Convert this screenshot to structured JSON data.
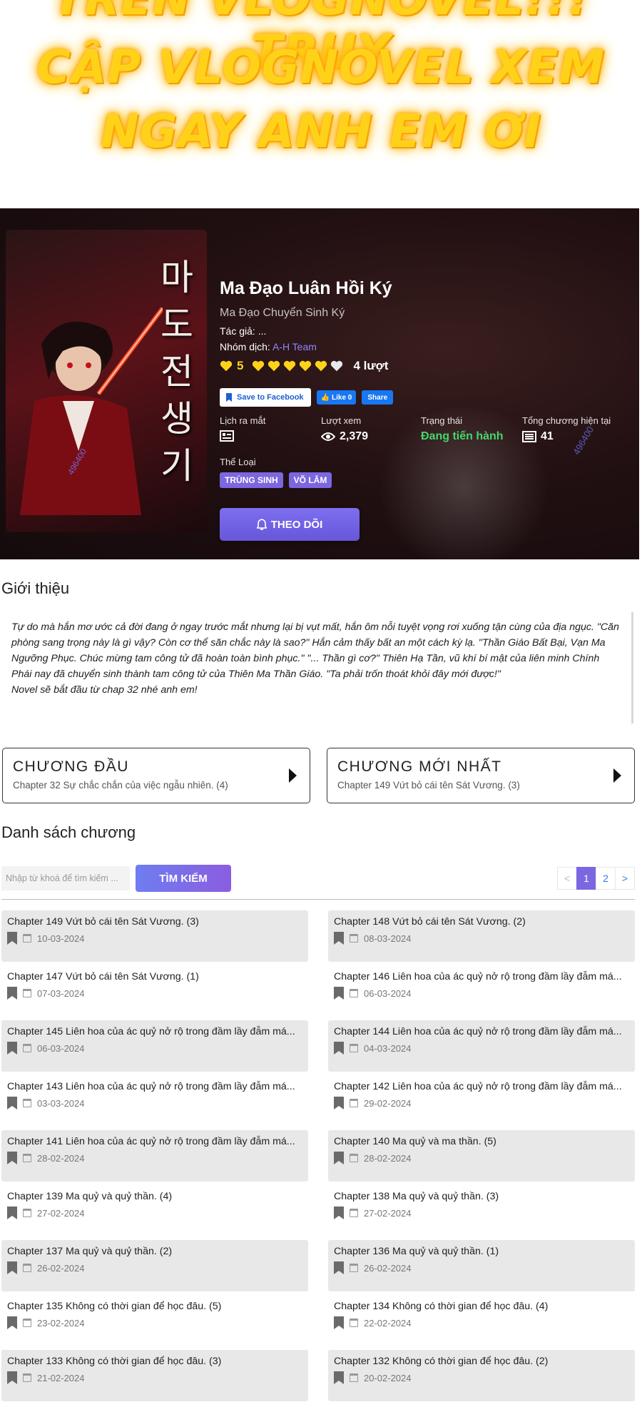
{
  "promo": {
    "line1": "TRÊN VLOGNOVEL!!! TRUY",
    "line2": "CẬP VLOGNOVEL XEM",
    "line3": "NGAY ANH EM ƠI"
  },
  "hero": {
    "title": "Ma Đạo Luân Hồi Ký",
    "alt_title": "Ma Đạo Chuyển Sinh Ký",
    "author_label": "Tác giả: ...",
    "team_label": "Nhóm dịch:",
    "team_name": "A-H Team",
    "rating_value": "5",
    "rating_count": "4 lượt",
    "hearts_filled": 5,
    "hearts_total": 6,
    "fb_save": "Save to Facebook",
    "fb_like": "Like 0",
    "fb_share": "Share",
    "cover_text": "마도전생기",
    "watermark": "496400",
    "stats": {
      "release_label": "Lịch ra mắt",
      "views_label": "Lượt xem",
      "views_value": "2,379",
      "status_label": "Trạng thái",
      "status_value": "Đang tiến hành",
      "chapters_label": "Tổng chương hiện tại",
      "chapters_value": "41"
    },
    "genre_label": "Thể Loại",
    "genres": [
      "TRÙNG SINH",
      "VÕ LÂM"
    ],
    "follow_label": "THEO DÕI"
  },
  "intro": {
    "title": "Giới thiệu",
    "paragraph": "Tự do mà hắn mơ ước cả đời đang ở ngay trước mắt nhưng lại bị vụt mất, hắn ôm nỗi tuyệt vọng rơi xuống tận cùng của địa ngục. \"Căn phòng sang trọng này là gì vậy? Còn cơ thể săn chắc này là sao?\" Hắn cảm thấy bất an một cách kỳ lạ. \"Thần Giáo Bất Bại, Vạn Ma Ngưỡng Phục. Chúc mừng tam công tử đã hoàn toàn bình phục.\" \"... Thần gì cơ?\" Thiên Hạ Tần, vũ khí bí mật của liên minh Chính Phái nay đã chuyển sinh thành tam công tử của Thiên Ma Thần Giáo. \"Ta phải trốn thoát khỏi đây mới được!\"",
    "note": "Novel sẽ bắt đầu từ chap 32 nhé anh em!"
  },
  "first_chapter": {
    "heading": "CHƯƠNG ĐẦU",
    "title": "Chapter 32 Sự chắc chắn của việc ngẫu nhiên. (4)"
  },
  "latest_chapter": {
    "heading": "CHƯƠNG MỚI NHẤT",
    "title": "Chapter 149 Vứt bỏ cái tên Sát Vương. (3)"
  },
  "chapter_list": {
    "title": "Danh sách chương",
    "search_placeholder": "Nhập từ khoá để tìm kiếm ...",
    "search_button": "TÌM KIẾM",
    "pager": {
      "prev": "<",
      "pages": [
        "1",
        "2"
      ],
      "next": ">"
    },
    "items": [
      {
        "name": "Chapter 149 Vứt bỏ cái tên Sát Vương. (3)",
        "date": "10-03-2024"
      },
      {
        "name": "Chapter 148 Vứt bỏ cái tên Sát Vương. (2)",
        "date": "08-03-2024"
      },
      {
        "name": "Chapter 147 Vứt bỏ cái tên Sát Vương. (1)",
        "date": "07-03-2024"
      },
      {
        "name": "Chapter 146 Liên hoa của ác quỷ nở rộ trong đầm lầy đẫm má...",
        "date": "06-03-2024"
      },
      {
        "name": "Chapter 145 Liên hoa của ác quỷ nở rộ trong đầm lầy đẫm má...",
        "date": "06-03-2024"
      },
      {
        "name": "Chapter 144 Liên hoa của ác quỷ nở rộ trong đầm lầy đẫm má...",
        "date": "04-03-2024"
      },
      {
        "name": "Chapter 143 Liên hoa của ác quỷ nở rộ trong đầm lầy đẫm má...",
        "date": "03-03-2024"
      },
      {
        "name": "Chapter 142 Liên hoa của ác quỷ nở rộ trong đầm lầy đẫm má...",
        "date": "29-02-2024"
      },
      {
        "name": "Chapter 141 Liên hoa của ác quỷ nở rộ trong đầm lầy đẫm má...",
        "date": "28-02-2024"
      },
      {
        "name": "Chapter 140 Ma quỷ và ma thần. (5)",
        "date": "28-02-2024"
      },
      {
        "name": "Chapter 139 Ma quỷ và quỷ thần. (4)",
        "date": "27-02-2024"
      },
      {
        "name": "Chapter 138 Ma quỷ và quỷ thần. (3)",
        "date": "27-02-2024"
      },
      {
        "name": "Chapter 137 Ma quỷ và quỷ thần. (2)",
        "date": "26-02-2024"
      },
      {
        "name": "Chapter 136 Ma quỷ và quỷ thần. (1)",
        "date": "26-02-2024"
      },
      {
        "name": "Chapter 135 Không có thời gian để học đâu. (5)",
        "date": "23-02-2024"
      },
      {
        "name": "Chapter 134 Không có thời gian để học đâu. (4)",
        "date": "22-02-2024"
      },
      {
        "name": "Chapter 133 Không có thời gian để học đâu. (3)",
        "date": "21-02-2024"
      },
      {
        "name": "Chapter 132 Không có thời gian để học đâu. (2)",
        "date": "20-02-2024"
      }
    ]
  },
  "colors": {
    "accent": "#7b67e0",
    "status_green": "#45d66b",
    "rating_gold": "#ffd21a",
    "fb_blue": "#1877f2"
  }
}
